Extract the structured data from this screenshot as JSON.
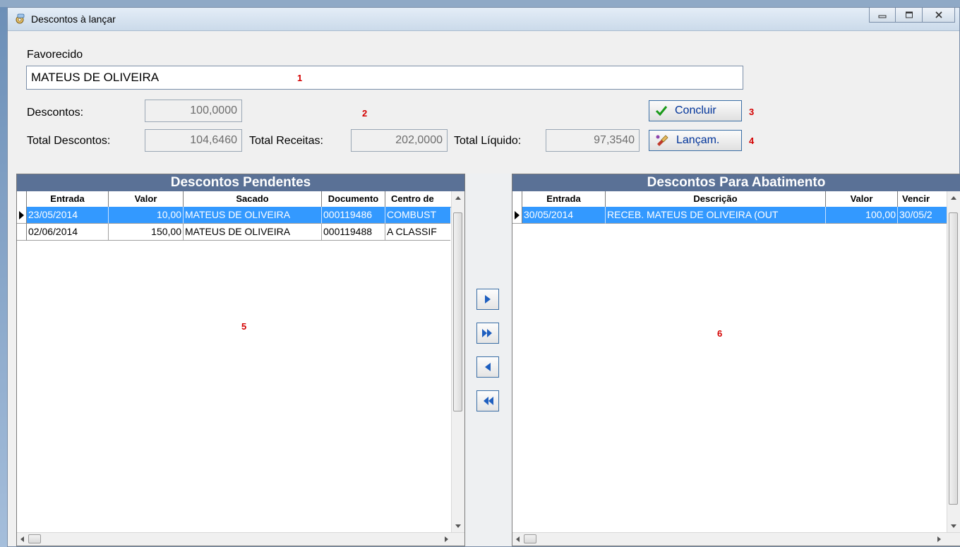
{
  "window": {
    "title": "Descontos à lançar",
    "icon": "gear-chat-icon",
    "controls": [
      "minimize-icon",
      "maximize-icon",
      "close-icon"
    ]
  },
  "favorecido": {
    "label": "Favorecido",
    "value": "MATEUS DE OLIVEIRA"
  },
  "totals": {
    "descontos_label": "Descontos:",
    "descontos_value": "100,0000",
    "total_descontos_label": "Total Descontos:",
    "total_descontos_value": "104,6460",
    "total_receitas_label": "Total Receitas:",
    "total_receitas_value": "202,0000",
    "total_liquido_label": "Total Líquido:",
    "total_liquido_value": "97,3540"
  },
  "buttons": {
    "concluir": "Concluir",
    "lancam": "Lançam.",
    "move_right_icon": "arrow-right-icon",
    "move_all_right_icon": "double-arrow-right-icon",
    "move_left_icon": "arrow-left-icon",
    "move_all_left_icon": "double-arrow-left-icon"
  },
  "markers": [
    "1",
    "2",
    "3",
    "4",
    "5",
    "6"
  ],
  "pendentes": {
    "title": "Descontos Pendentes",
    "columns": [
      "Entrada",
      "Valor",
      "Sacado",
      "Documento",
      "Centro de"
    ],
    "rows": [
      [
        "23/05/2014",
        "10,00",
        "MATEUS DE OLIVEIRA",
        "000119486",
        "COMBUST"
      ],
      [
        "02/06/2014",
        "150,00",
        "MATEUS DE OLIVEIRA",
        "000119488",
        "A CLASSIF"
      ]
    ],
    "selected_row": 0
  },
  "abatimento": {
    "title": "Descontos Para Abatimento",
    "columns": [
      "Entrada",
      "Descrição",
      "Valor",
      "Vencir"
    ],
    "rows": [
      [
        "30/05/2014",
        "RECEB. MATEUS DE OLIVEIRA (OUT",
        "100,00",
        "30/05/2"
      ]
    ],
    "selected_row": 0
  },
  "colors": {
    "grid_title_bg": "#5a7196",
    "selection": "#3399ff",
    "accent_button_border": "#3a6ea5",
    "marker": "#d40000"
  }
}
